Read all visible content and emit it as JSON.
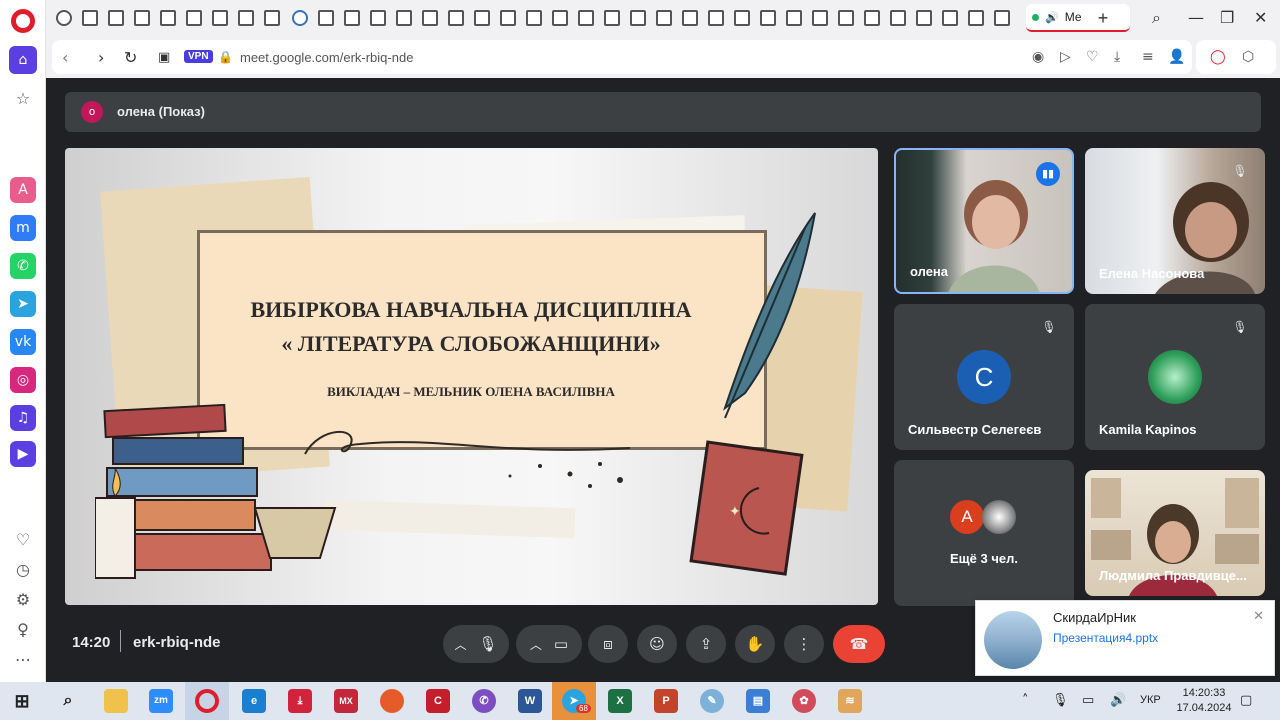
{
  "browser": {
    "active_tab_label": "Ме",
    "url": "meet.google.com/erk-rbiq-nde",
    "vpn_label": "VPN"
  },
  "meet": {
    "presenter_initial": "о",
    "presenter_label": "олена (Показ)",
    "slide": {
      "title_line1": "ВИБІРКОВА НАВЧАЛЬНА ДИСЦИПЛІНА",
      "title_line2": "« ЛІТЕРАТУРА СЛОБОЖАНЩИНИ»",
      "subtitle": "ВИКЛАДАЧ – МЕЛЬНИК ОЛЕНА ВАСИЛІВНА"
    },
    "participants": [
      {
        "name": "олена",
        "status": "speaking"
      },
      {
        "name": "Елена Насонова",
        "status": "muted"
      },
      {
        "name": "Сильвестр Селегеєв",
        "initial": "С",
        "status": "muted"
      },
      {
        "name": "Kamila Kapinos",
        "status": "muted"
      },
      {
        "name": "Ещё 3 чел.",
        "initial": "А"
      },
      {
        "name": "Людмила Правдивце..."
      }
    ],
    "time": "14:20",
    "meeting_code": "erk-rbiq-nde"
  },
  "notification": {
    "sender": "СкирдаИрНик",
    "file": "Презентация4.pptx"
  },
  "taskbar": {
    "language": "УКР",
    "clock_time": "14:20:33",
    "clock_date": "17.04.2024",
    "telegram_badge": "68"
  },
  "colors": {
    "accent_blue": "#1a73e8",
    "end_call": "#ea4335",
    "opera_red": "#e11d2c",
    "meet_bg": "#202124",
    "tile_bg": "#3c4043"
  },
  "icons": [
    "opera-icon",
    "home-icon",
    "star-icon",
    "messenger-icon",
    "whatsapp-icon",
    "telegram-icon",
    "vk-icon",
    "instagram-icon",
    "music-icon",
    "player-icon",
    "heart-icon",
    "history-icon",
    "settings-icon",
    "lightbulb-icon",
    "more-icon",
    "mic-icon",
    "camera-icon",
    "captions-icon",
    "emoji-icon",
    "present-icon",
    "hand-icon",
    "end-call-icon"
  ]
}
